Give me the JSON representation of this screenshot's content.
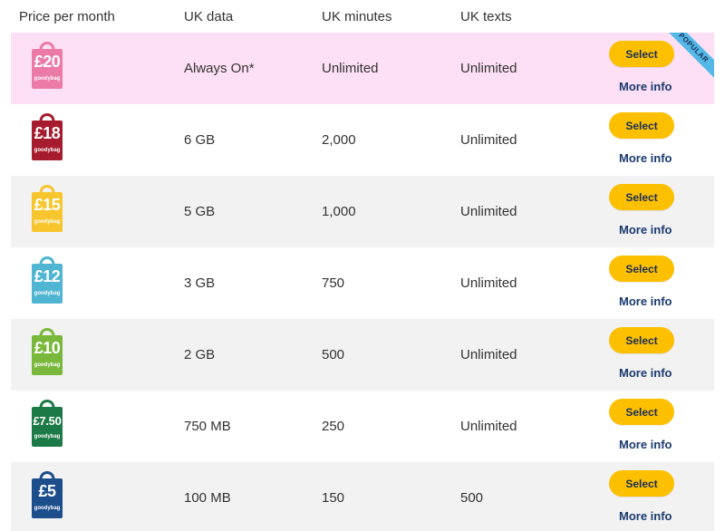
{
  "header": {
    "price": "Price per month",
    "data": "UK data",
    "minutes": "UK minutes",
    "texts": "UK texts"
  },
  "colors": {
    "popular_row_bg": "#fde0f5",
    "alt_row_bg": "#f2f2f2",
    "plain_row_bg": "#ffffff",
    "select_button": "#fdc000",
    "more_info_text": "#1a3a6e",
    "ribbon": "#53b8e6"
  },
  "plans": [
    {
      "price": "£20",
      "brand": "goodybag",
      "bag_color": "#ec7aa6",
      "data": "Always On*",
      "minutes": "Unlimited",
      "texts": "Unlimited",
      "select": "Select",
      "more_info": "More info",
      "popular": "POPULAR",
      "row_style": "popular"
    },
    {
      "price": "£18",
      "brand": "goodybag",
      "bag_color": "#a61c2e",
      "data": "6 GB",
      "minutes": "2,000",
      "texts": "Unlimited",
      "select": "Select",
      "more_info": "More info",
      "row_style": "plain"
    },
    {
      "price": "£15",
      "brand": "goodybag",
      "bag_color": "#f7c62f",
      "data": "5 GB",
      "minutes": "1,000",
      "texts": "Unlimited",
      "select": "Select",
      "more_info": "More info",
      "row_style": "alt"
    },
    {
      "price": "£12",
      "brand": "goodybag",
      "bag_color": "#4fb5d2",
      "data": "3 GB",
      "minutes": "750",
      "texts": "Unlimited",
      "select": "Select",
      "more_info": "More info",
      "row_style": "plain"
    },
    {
      "price": "£10",
      "brand": "goodybag",
      "bag_color": "#79b83a",
      "data": "2 GB",
      "minutes": "500",
      "texts": "Unlimited",
      "select": "Select",
      "more_info": "More info",
      "row_style": "alt"
    },
    {
      "price": "£7.50",
      "brand": "goodybag",
      "bag_color": "#1c7a47",
      "data": "750 MB",
      "minutes": "250",
      "texts": "Unlimited",
      "select": "Select",
      "more_info": "More info",
      "row_style": "plain"
    },
    {
      "price": "£5",
      "brand": "goodybag",
      "bag_color": "#1d4e8c",
      "data": "100 MB",
      "minutes": "150",
      "texts": "500",
      "select": "Select",
      "more_info": "More info",
      "row_style": "alt"
    }
  ]
}
